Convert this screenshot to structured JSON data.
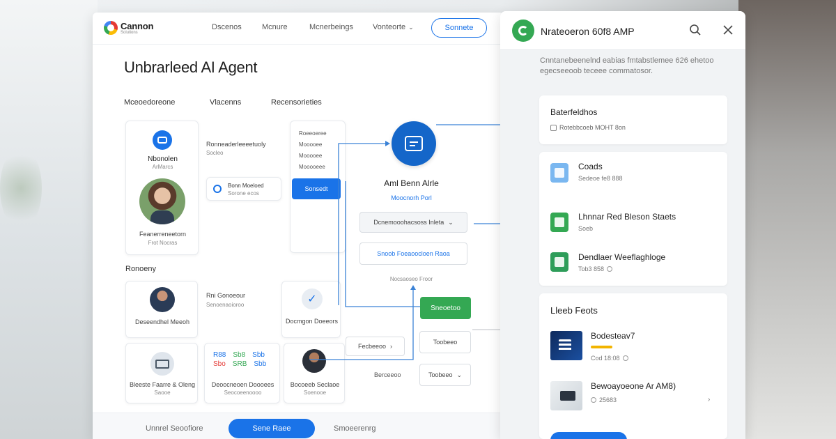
{
  "main": {
    "logo": {
      "name": "Cannon",
      "sub": "Solutions"
    },
    "nav": {
      "links": [
        "Dscenos",
        "Mcnure",
        "Mcnerbeings",
        "Vonteorte"
      ],
      "cta": "Sonnete"
    },
    "title": "Unbrarleed AI Agent",
    "tabs": [
      "Mceoedoreone",
      "Vlacenns",
      "Recensorieties"
    ],
    "profile_card": {
      "name": "Nbonolen",
      "sub": "ArMarcs",
      "caption": "Feanerreneetorn",
      "caption_sub": "Frot Nocras"
    },
    "settings_card": {
      "title": "Ronneaderleeeetuoly",
      "sub": "Socleo",
      "field_text": "Bonn Moeloed",
      "field_sub": "Sorone ecos"
    },
    "list_card": {
      "items": [
        "Roeeoeree",
        "Mooooee",
        "Mooooee",
        "Mooooeee"
      ],
      "button": "Sonsedt"
    },
    "agent_card": {
      "title": "Aml Benn Alrle",
      "link": "Moocnorh Porl",
      "select": "Dcnemooohacsoss Inleta",
      "button": "Snoob Foeaoocloen Raoa",
      "footer": "Nocsaoseo Froor"
    },
    "green_button": "Sneoetoo",
    "section": "Ronoeny",
    "row_cards": [
      {
        "title": "Deseendhel Meeoh"
      },
      {
        "title": "Rni Gonoeour",
        "sub": "Senoenaoioroo"
      },
      {
        "title": "Docmgon Doeeors"
      }
    ],
    "bottom_cards": [
      {
        "title": "Bleeste Faarre & Oleng",
        "sub": "Saooe"
      },
      {
        "codes": [
          "R88",
          "Sb8",
          "Sbb",
          "Sbo",
          "SRB",
          "Sbb"
        ],
        "title": "Deoocneoen Doooees",
        "sub": "Seocoeenoooo"
      },
      {
        "title": "Bocoeeb Seclaoe",
        "sub": "Soenooe"
      }
    ],
    "flow_boxes": [
      "Fecbeeoo",
      "Toobeeo",
      "Toobeeo",
      "Berceeoo"
    ],
    "bottom_bar": {
      "left": "Unnrel Seoofiore",
      "primary": "Sene Raee",
      "right": "Smoeerenrg"
    }
  },
  "side": {
    "title": "Nrateoeron 60f8 AMP",
    "description": "Cnntanebeenelnd eabias fmtabstlemee 626 ehetoo egecseeoob teceee commatosor.",
    "card1": {
      "title": "Baterfeldhos",
      "sub": "Rotebbcoeb MOHT 8on"
    },
    "docs": [
      {
        "title": "Coads",
        "sub": "Sedeoe fe8 888",
        "color": "#4f9be8"
      },
      {
        "title": "Lhnnar Red Bleson Staets",
        "sub": "Soeb",
        "color": "#34a853"
      },
      {
        "title": "Dendlaer Weeflaghloge",
        "sub": "Tob3 858",
        "color": "#2e9d5a"
      }
    ],
    "web_tools": {
      "title": "Lleeb Feots",
      "items": [
        {
          "title": "Bodesteav7",
          "sub": "Cod 18:08"
        },
        {
          "title": "Bewoayoeone Ar AM8)",
          "sub": "25683"
        }
      ]
    },
    "colors": {
      "accent": "#1a73e8",
      "green": "#34a853"
    }
  }
}
